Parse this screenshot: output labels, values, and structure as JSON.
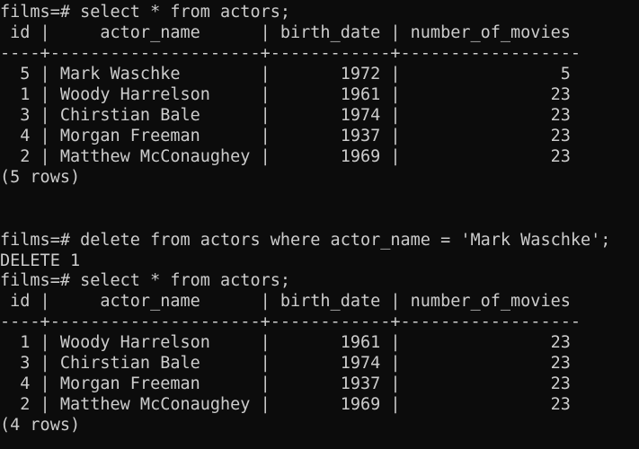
{
  "terminal": {
    "lines": [
      "films=# select * from actors;",
      " id |     actor_name      | birth_date | number_of_movies",
      "----+---------------------+------------+------------------",
      "  5 | Mark Waschke        |       1972 |                5",
      "  1 | Woody Harrelson     |       1961 |               23",
      "  3 | Chirstian Bale      |       1974 |               23",
      "  4 | Morgan Freeman      |       1937 |               23",
      "  2 | Matthew McConaughey |       1969 |               23",
      "(5 rows)",
      "",
      "",
      "films=# delete from actors where actor_name = 'Mark Waschke';",
      "DELETE 1",
      "films=# select * from actors;",
      " id |     actor_name      | birth_date | number_of_movies",
      "----+---------------------+------------+------------------",
      "  1 | Woody Harrelson     |       1961 |               23",
      "  3 | Chirstian Bale      |       1974 |               23",
      "  4 | Morgan Freeman      |       1937 |               23",
      "  2 | Matthew McConaughey |       1969 |               23",
      "(4 rows)"
    ]
  }
}
